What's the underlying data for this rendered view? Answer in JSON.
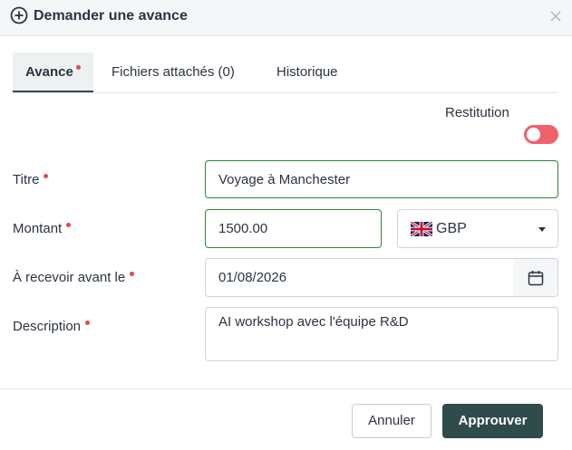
{
  "dialog": {
    "title": "Demander une avance",
    "icon": "plus-circle-icon",
    "close_icon": "close-icon"
  },
  "tabs": [
    {
      "label": "Avance",
      "active": true,
      "required": true
    },
    {
      "label": "Fichiers attachés (0)",
      "active": false
    },
    {
      "label": "Historique",
      "active": false
    }
  ],
  "restitution": {
    "label": "Restitution",
    "enabled": false,
    "toggle_color": "#f0626b"
  },
  "form": {
    "title": {
      "label": "Titre",
      "value": "Voyage à Manchester"
    },
    "amount": {
      "label": "Montant",
      "value": "1500.00"
    },
    "currency": {
      "value": "GBP",
      "flag": "uk-flag-icon"
    },
    "due_date": {
      "label": "À recevoir avant le",
      "value": "01/08/2026",
      "icon": "calendar-icon"
    },
    "description": {
      "label": "Description",
      "value": "AI workshop avec l'équipe R&D"
    }
  },
  "buttons": {
    "cancel": "Annuler",
    "approve": "Approuver"
  },
  "colors": {
    "primary": "#2f4b4a",
    "required": "#e5484d",
    "valid_border": "#2e8540"
  }
}
